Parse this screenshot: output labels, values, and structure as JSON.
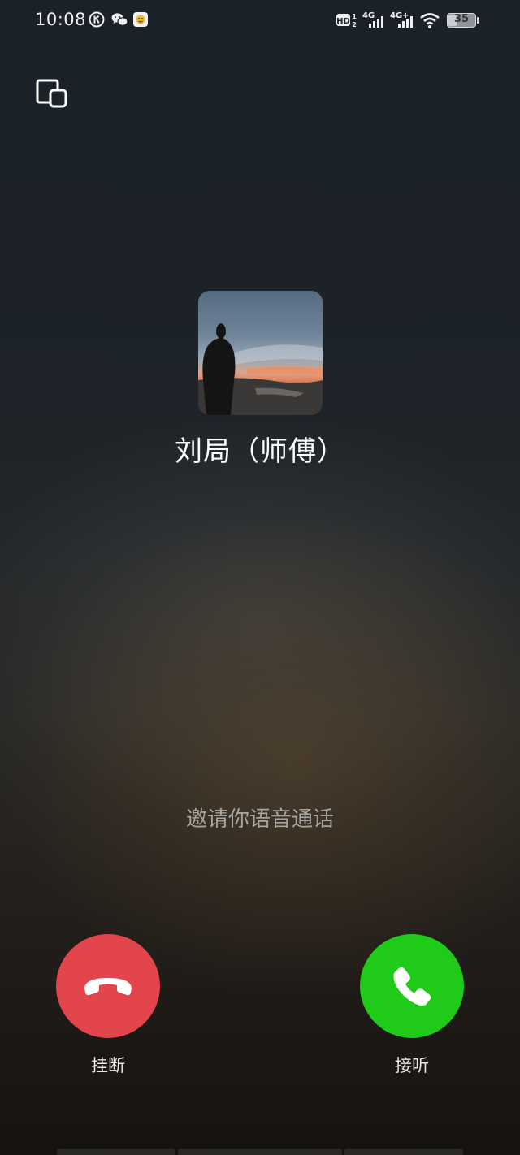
{
  "status_bar": {
    "time": "10:08",
    "left_icons": [
      "k-circle-icon",
      "wechat-icon",
      "app-badge-icon"
    ],
    "right_icons": [
      "hd-icon",
      "signal-4g-icon",
      "signal-4g-plus-icon",
      "wifi-icon"
    ],
    "battery": {
      "level_percent": 35,
      "text": "35"
    }
  },
  "header": {
    "minimize_icon": "minimize-window-icon"
  },
  "caller": {
    "name": "刘局（师傅）",
    "avatar": "avatar-photo"
  },
  "call": {
    "status_text": "邀请你语音通话"
  },
  "actions": {
    "decline_label": "挂断",
    "accept_label": "接听"
  },
  "colors": {
    "decline": "#e2454c",
    "accept": "#1fca18",
    "status_text": "#a7a6a3"
  }
}
